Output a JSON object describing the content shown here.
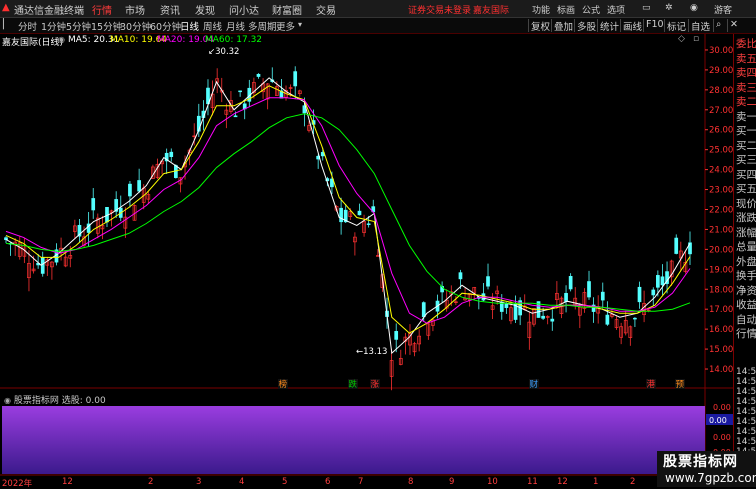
{
  "topbar": {
    "title": "通达信金融终端",
    "menus": [
      "行情",
      "市场",
      "资讯",
      "发现",
      "问小达",
      "财富圈",
      "交易"
    ],
    "notice": "证券交易未登录",
    "broker": "嘉友国际",
    "right_menus": [
      "功能",
      "标画",
      "公式",
      "选项"
    ],
    "guest": "游客"
  },
  "toolbar": {
    "periods": [
      "分时",
      "1分钟",
      "5分钟",
      "15分钟",
      "30分钟",
      "60分钟",
      "日线",
      "周线",
      "月线",
      "多周期",
      "更多"
    ],
    "right_buttons": [
      "复权",
      "叠加",
      "多股",
      "统计",
      "画线",
      "F10",
      "标记",
      "自选"
    ]
  },
  "legend": {
    "stock": "嘉友国际(日线)",
    "ma5": "MA5: 20.31",
    "ma10": "MA10: 19.64",
    "ma20": "MA20: 19.04",
    "ma60": "MA60: 17.32"
  },
  "colors": {
    "ma5": "#ffffff",
    "ma10": "#ffff00",
    "ma20": "#ff00ff",
    "ma60": "#00ff00",
    "up": "#ff3232",
    "down": "#54ffff"
  },
  "price_axis": [
    "30.00",
    "29.00",
    "28.00",
    "27.00",
    "26.00",
    "25.00",
    "24.00",
    "23.00",
    "22.00",
    "21.00",
    "20.00",
    "19.00",
    "18.00",
    "17.00",
    "16.00",
    "15.00",
    "14.00"
  ],
  "annotations": {
    "high": "30.32",
    "low": "13.13"
  },
  "markers": [
    "榜",
    "跌",
    "涨",
    "财",
    "港",
    "预"
  ],
  "indicator": {
    "title": "股票指标网",
    "sub": "选股: 0.00",
    "axis": [
      "0.00",
      "0.00",
      "0.00",
      "0.00",
      "0.00"
    ],
    "current": "0.00"
  },
  "right_panel": {
    "items": [
      "委比",
      "卖五",
      "卖四",
      "卖三",
      "卖二",
      "卖一",
      "买一",
      "买二",
      "买三",
      "买四",
      "买五",
      "现价",
      "涨跌",
      "涨幅",
      "总量",
      "外盘",
      "换手",
      "净资",
      "收益",
      "自动",
      "行情"
    ],
    "times": [
      "14:50",
      "14:50",
      "14:50",
      "14:50",
      "14:50",
      "14:50",
      "14:50",
      "14:50",
      "14:50",
      "14:50",
      "14:50",
      "14:50"
    ]
  },
  "date_axis": [
    "2022年",
    "12",
    "2",
    "3",
    "4",
    "5",
    "6",
    "7",
    "8",
    "9",
    "10",
    "11",
    "12",
    "1",
    "2"
  ],
  "watermark": {
    "line1": "股票指标网",
    "line2": "www.7gpzb.com"
  },
  "chart_data": {
    "type": "line",
    "title": "嘉友国际(日线)",
    "ylim": [
      13.5,
      30.8
    ],
    "series": [
      {
        "name": "MA5",
        "values": [
          20.5,
          20.0,
          19.2,
          19.8,
          20.6,
          21.4,
          21.8,
          22.4,
          23.2,
          24.6,
          24.0,
          26.0,
          28.4,
          27.0,
          27.8,
          28.6,
          27.9,
          27.4,
          24.2,
          21.6,
          21.2,
          21.8,
          14.8,
          15.6,
          16.8,
          17.4,
          18.2,
          17.6,
          17.4,
          17.2,
          16.8,
          17.0,
          17.4,
          17.2,
          17.0,
          16.6,
          16.8,
          17.6,
          18.8,
          20.31
        ]
      },
      {
        "name": "MA10",
        "values": [
          20.7,
          20.3,
          19.6,
          19.6,
          20.2,
          21.0,
          21.5,
          22.1,
          22.8,
          23.8,
          24.0,
          25.4,
          27.2,
          27.2,
          27.6,
          28.2,
          27.8,
          27.5,
          25.2,
          22.6,
          21.6,
          21.4,
          16.6,
          15.8,
          16.3,
          17.0,
          17.8,
          17.7,
          17.5,
          17.3,
          17.0,
          17.0,
          17.2,
          17.2,
          17.0,
          16.8,
          16.8,
          17.2,
          18.3,
          19.64
        ]
      },
      {
        "name": "MA20",
        "values": [
          20.9,
          20.6,
          20.1,
          19.8,
          20.0,
          20.5,
          21.0,
          21.6,
          22.2,
          23.0,
          23.5,
          24.6,
          26.2,
          26.8,
          27.2,
          27.6,
          27.6,
          27.5,
          26.2,
          24.2,
          22.8,
          21.8,
          18.8,
          16.8,
          16.3,
          16.6,
          17.3,
          17.6,
          17.6,
          17.4,
          17.2,
          17.1,
          17.2,
          17.2,
          17.1,
          16.9,
          16.9,
          17.1,
          17.8,
          19.04
        ]
      },
      {
        "name": "MA60",
        "values": [
          20.3,
          20.2,
          20.0,
          19.9,
          20.0,
          20.2,
          20.5,
          20.8,
          21.3,
          21.9,
          22.4,
          23.1,
          24.1,
          24.8,
          25.4,
          26.1,
          26.6,
          26.8,
          26.6,
          26.0,
          25.0,
          23.8,
          22.0,
          20.2,
          18.9,
          18.0,
          17.6,
          17.4,
          17.3,
          17.3,
          17.3,
          17.2,
          17.2,
          17.1,
          17.1,
          17.0,
          16.9,
          16.9,
          17.0,
          17.32
        ]
      }
    ]
  }
}
